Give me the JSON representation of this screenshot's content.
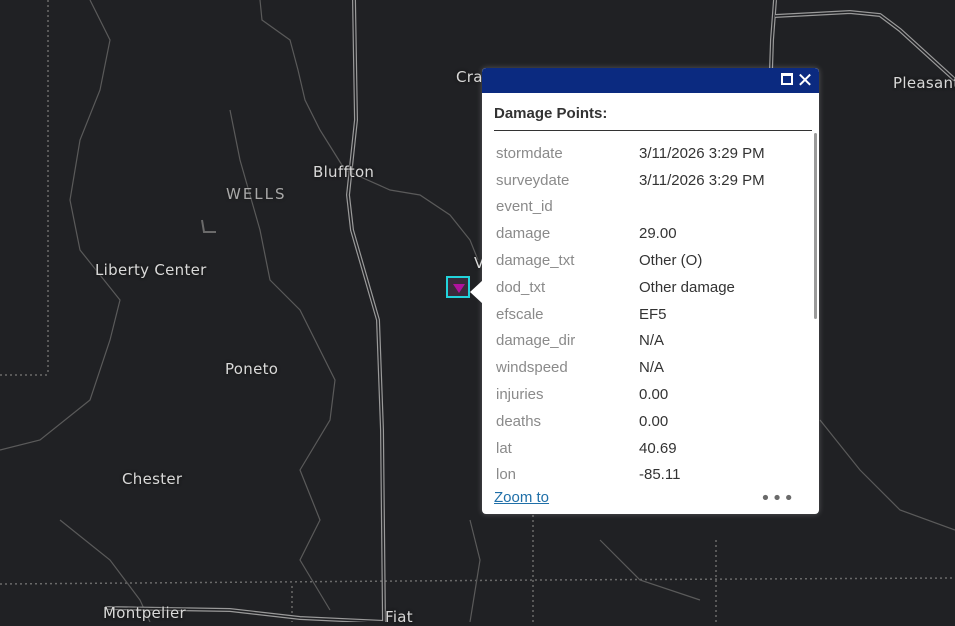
{
  "map": {
    "labels": {
      "cra": "Cra",
      "pleasant": "Pleasant",
      "bluffton": "Bluffton",
      "wells": "WELLS",
      "liberty_center": "Liberty Center",
      "poneto": "Poneto",
      "chester": "Chester",
      "montpelier": "Montpelier",
      "fiat": "Fiat",
      "v_partial": "V"
    },
    "colors": {
      "background": "#202124",
      "roads": "#9a9a9a",
      "marker_outline": "#22d3db",
      "marker_fill": "#b0129e"
    }
  },
  "popup": {
    "title": "Damage Points:",
    "header_color": "#0b2a80",
    "maximize_icon": "maximize-icon",
    "close_icon": "close-icon",
    "close_glyph": "✕",
    "attributes": [
      {
        "key": "stormdate",
        "value": "3/11/2026 3:29 PM"
      },
      {
        "key": "surveydate",
        "value": "3/11/2026 3:29 PM"
      },
      {
        "key": "event_id",
        "value": ""
      },
      {
        "key": "damage",
        "value": "29.00"
      },
      {
        "key": "damage_txt",
        "value": "Other (O)"
      },
      {
        "key": "dod_txt",
        "value": "Other damage"
      },
      {
        "key": "efscale",
        "value": "EF5"
      },
      {
        "key": "damage_dir",
        "value": "N/A"
      },
      {
        "key": "windspeed",
        "value": "N/A"
      },
      {
        "key": "injuries",
        "value": "0.00"
      },
      {
        "key": "deaths",
        "value": "0.00"
      },
      {
        "key": "lat",
        "value": "40.69"
      },
      {
        "key": "lon",
        "value": "-85.11"
      }
    ],
    "zoom_label": "Zoom to",
    "more_label": "•••"
  }
}
